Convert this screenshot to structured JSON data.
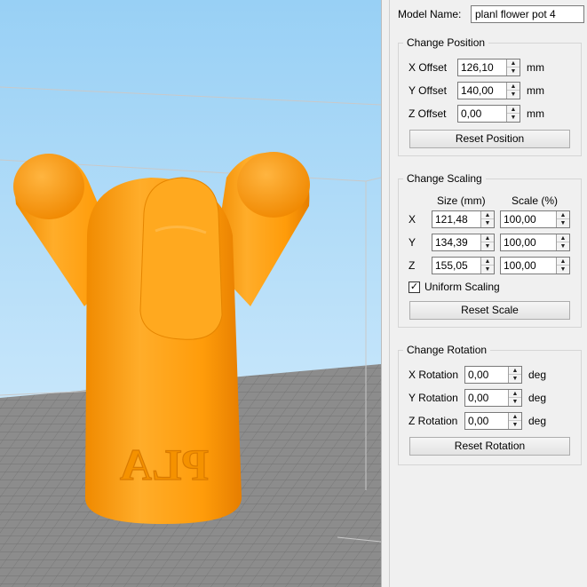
{
  "model": {
    "label": "Model Name:",
    "value": "planl flower pot 4"
  },
  "position": {
    "title": "Change Position",
    "rows": [
      {
        "label": "X Offset",
        "value": "126,10",
        "unit": "mm"
      },
      {
        "label": "Y Offset",
        "value": "140,00",
        "unit": "mm"
      },
      {
        "label": "Z Offset",
        "value": "0,00",
        "unit": "mm"
      }
    ],
    "reset_label": "Reset Position"
  },
  "scaling": {
    "title": "Change Scaling",
    "size_header": "Size (mm)",
    "scale_header": "Scale (%)",
    "rows": [
      {
        "axis": "X",
        "size": "121,48",
        "scale": "100,00"
      },
      {
        "axis": "Y",
        "size": "134,39",
        "scale": "100,00"
      },
      {
        "axis": "Z",
        "size": "155,05",
        "scale": "100,00"
      }
    ],
    "uniform_label": "Uniform Scaling",
    "uniform_checked": true,
    "reset_label": "Reset Scale"
  },
  "rotation": {
    "title": "Change Rotation",
    "rows": [
      {
        "label": "X Rotation",
        "value": "0,00",
        "unit": "deg"
      },
      {
        "label": "Y Rotation",
        "value": "0,00",
        "unit": "deg"
      },
      {
        "label": "Z Rotation",
        "value": "0,00",
        "unit": "deg"
      }
    ],
    "reset_label": "Reset Rotation"
  },
  "viewport": {
    "embossed_text": "PLA"
  },
  "colors": {
    "model_orange": "#ff9f0a",
    "sky_top": "#98d0f5",
    "sky_bottom": "#d9eefc",
    "floor": "#8a8a8a"
  },
  "icons": {
    "spin_up": "triangle-up-icon",
    "spin_down": "triangle-down-icon",
    "check": "checkmark-icon"
  }
}
